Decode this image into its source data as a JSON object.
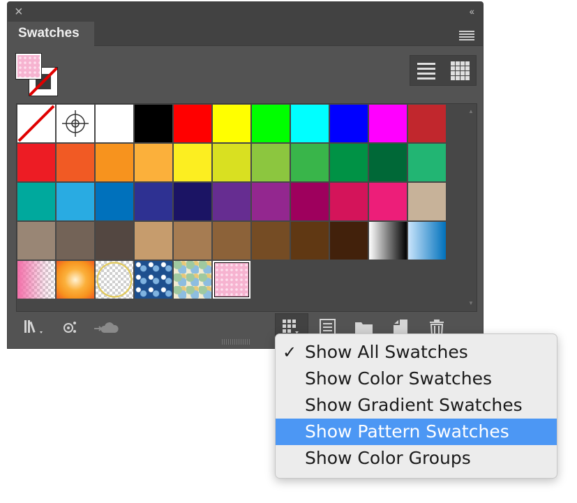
{
  "panel": {
    "tab_title": "Swatches",
    "close_glyph": "×",
    "collapse_glyph": "‹‹"
  },
  "swatches": [
    {
      "kind": "none"
    },
    {
      "kind": "registration"
    },
    {
      "color": "#ffffff"
    },
    {
      "color": "#000000"
    },
    {
      "color": "#ff0000"
    },
    {
      "color": "#ffff00"
    },
    {
      "color": "#00ff00"
    },
    {
      "color": "#00ffff"
    },
    {
      "color": "#0000ff"
    },
    {
      "color": "#ff00ff"
    },
    {
      "color": "#c1272d"
    },
    {
      "color": "#ed1c24"
    },
    {
      "color": "#f15a24"
    },
    {
      "color": "#f7931e"
    },
    {
      "color": "#fbb03b"
    },
    {
      "color": "#fcee21"
    },
    {
      "color": "#d9e021"
    },
    {
      "color": "#8cc63f"
    },
    {
      "color": "#39b54a"
    },
    {
      "color": "#009245"
    },
    {
      "color": "#006837"
    },
    {
      "color": "#22b573"
    },
    {
      "color": "#00a99d"
    },
    {
      "color": "#29abe2"
    },
    {
      "color": "#0071bc"
    },
    {
      "color": "#2e3192"
    },
    {
      "color": "#1b1464"
    },
    {
      "color": "#662d91"
    },
    {
      "color": "#93278f"
    },
    {
      "color": "#9e005d"
    },
    {
      "color": "#d4145a"
    },
    {
      "color": "#ed1e79"
    },
    {
      "color": "#c7b299"
    },
    {
      "color": "#998675"
    },
    {
      "color": "#736357"
    },
    {
      "color": "#534741"
    },
    {
      "color": "#c69c6d"
    },
    {
      "color": "#a67c52"
    },
    {
      "color": "#8c6239"
    },
    {
      "color": "#754c24"
    },
    {
      "color": "#603813"
    },
    {
      "color": "#42210b"
    },
    {
      "kind": "gradient",
      "css": "linear-gradient(90deg,#ffffff,#000000)"
    },
    {
      "kind": "gradient",
      "css": "linear-gradient(90deg,#c9e4fb,#0071bc)"
    },
    {
      "kind": "gradient",
      "css": "linear-gradient(90deg,#f36fa9 0%,rgba(243,111,169,0.2) 70%,transparent 100%)",
      "checker": true
    },
    {
      "kind": "gradient",
      "css": "radial-gradient(circle,#fff3d6 0%,#fbb03b 40%,#f7931e 70%,#f15a24 100%)"
    },
    {
      "kind": "gradient",
      "css": "radial-gradient(circle,transparent 60%,#e1c95a 62%,#e1c95a 66%,transparent 68%)",
      "checker": true
    },
    {
      "kind": "pattern",
      "css": "radial-gradient(circle at 30% 30%,#ffffff 0 3px,transparent 4px),radial-gradient(circle at 70% 60%,#7fb3e0 0 4px,transparent 5px),#1d4f8e"
    },
    {
      "kind": "pattern",
      "css": "radial-gradient(ellipse at 30% 30%,#9fc9a0 0 6px,transparent 7px),radial-gradient(ellipse at 70% 70%,#8dbde0 0 6px,transparent 7px),radial-gradient(ellipse at 75% 25%,#e8c978 0 4px,transparent 5px),#f3ecd1"
    },
    {
      "kind": "pattern",
      "selected": true,
      "css": "radial-gradient(circle at 4px 4px,#fde0ee 1.6px,transparent 2px),#f6b3d0"
    }
  ],
  "menu": {
    "checkmark": "✓",
    "items": [
      {
        "label": "Show All Swatches",
        "checked": true
      },
      {
        "label": "Show Color Swatches"
      },
      {
        "label": "Show Gradient Swatches"
      },
      {
        "label": "Show Pattern Swatches",
        "highlighted": true
      },
      {
        "label": "Show Color Groups"
      }
    ]
  }
}
